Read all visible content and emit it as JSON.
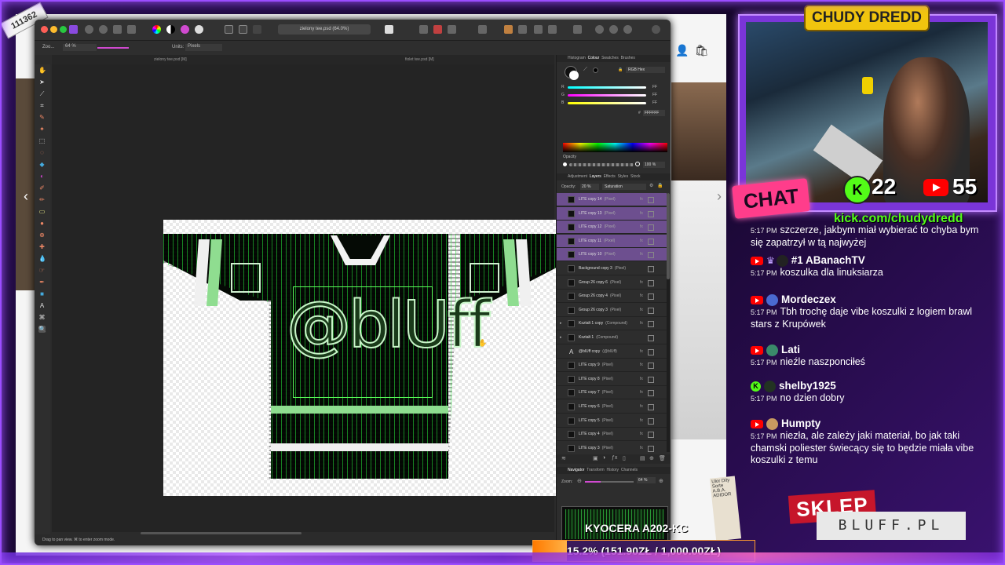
{
  "overlay": {
    "counter_badge": "111362",
    "streamer_name": "CHUDY DREDD",
    "chat_label": "CHAT",
    "kick_count": "22",
    "youtube_count": "55",
    "kick_url": "kick.com/chudydredd",
    "sklep_label": "SKLEP",
    "bluff_label": "BLUFF.PL",
    "printer_label": "KYOCERA A202-KC",
    "goal_text": "15.2% (151.90ZŁ / 1,000.00ZŁ)",
    "goal_progress": 0.152,
    "colors": {
      "accent": "#9b4dff",
      "kick": "#53fc18",
      "youtube": "#ff0000",
      "chat_label": "#ff3d8b",
      "name_bg": "#f1c50e"
    }
  },
  "app": {
    "document_title": "zielony tee.psd (64.0%)",
    "context": {
      "zoom_label": "Zoo...",
      "zoom_value": "64 %",
      "units_label": "Units:",
      "units_value": "Pixels"
    },
    "tabs": [
      "zielony tee.psd [M]",
      "fiolet tee.psd [M]"
    ],
    "status": "Drag to pan view. ⌘ to enter zoom mode.",
    "document": {
      "logo_text": "@blUff"
    },
    "colour_panel": {
      "tabs": [
        "Histogram",
        "Colour",
        "Swatches",
        "Brushes"
      ],
      "active_tab": "Colour",
      "mode": "RGB Hex",
      "channels": [
        {
          "label": "R",
          "value": "FF"
        },
        {
          "label": "G",
          "value": "FF"
        },
        {
          "label": "B",
          "value": "FF"
        }
      ],
      "hex_label": "#",
      "hex": "FFFFFF",
      "opacity_label": "Opacity",
      "opacity_value": "100 %"
    },
    "layers_panel": {
      "tabs": [
        "Adjustment",
        "Layers",
        "Effects",
        "Styles",
        "Stock"
      ],
      "active_tab": "Layers",
      "opacity_label": "Opacity:",
      "opacity_value": "20 %",
      "blend_mode": "Saturation",
      "layers": [
        {
          "name": "LITE copy 14",
          "type": "(Pixel)",
          "selected": true,
          "expandable": false,
          "fx": true,
          "icon": "pixel"
        },
        {
          "name": "LITE copy 13",
          "type": "(Pixel)",
          "selected": true,
          "expandable": false,
          "fx": true,
          "icon": "pixel"
        },
        {
          "name": "LITE copy 12",
          "type": "(Pixel)",
          "selected": true,
          "expandable": false,
          "fx": true,
          "icon": "pixel"
        },
        {
          "name": "LITE copy 11",
          "type": "(Pixel)",
          "selected": true,
          "expandable": false,
          "fx": true,
          "icon": "pixel"
        },
        {
          "name": "LITE copy 10",
          "type": "(Pixel)",
          "selected": true,
          "expandable": false,
          "fx": true,
          "icon": "pixel"
        },
        {
          "name": "Background copy 3",
          "type": "(Pixel)",
          "selected": false,
          "expandable": false,
          "fx": false,
          "icon": "pixel"
        },
        {
          "name": "Group 26 copy 6",
          "type": "(Pixel)",
          "selected": false,
          "expandable": false,
          "fx": true,
          "icon": "pixel"
        },
        {
          "name": "Group 26 copy 4",
          "type": "(Pixel)",
          "selected": false,
          "expandable": false,
          "fx": true,
          "icon": "pixel"
        },
        {
          "name": "Group 26 copy 3",
          "type": "(Pixel)",
          "selected": false,
          "expandable": false,
          "fx": true,
          "icon": "pixel"
        },
        {
          "name": "Kształt 1 copy",
          "type": "(Compound)",
          "selected": false,
          "expandable": true,
          "fx": true,
          "icon": "pixel"
        },
        {
          "name": "Kształt 1",
          "type": "(Compound)",
          "selected": false,
          "expandable": true,
          "fx": false,
          "icon": "pixel"
        },
        {
          "name": "@blUff copy",
          "type": "(@blUff)",
          "selected": false,
          "expandable": false,
          "fx": true,
          "icon": "text"
        },
        {
          "name": "LITE copy 9",
          "type": "(Pixel)",
          "selected": false,
          "expandable": false,
          "fx": true,
          "icon": "pixel"
        },
        {
          "name": "LITE copy 8",
          "type": "(Pixel)",
          "selected": false,
          "expandable": false,
          "fx": true,
          "icon": "pixel"
        },
        {
          "name": "LITE copy 7",
          "type": "(Pixel)",
          "selected": false,
          "expandable": false,
          "fx": true,
          "icon": "pixel"
        },
        {
          "name": "LITE copy 6",
          "type": "(Pixel)",
          "selected": false,
          "expandable": false,
          "fx": true,
          "icon": "pixel"
        },
        {
          "name": "LITE copy 5",
          "type": "(Pixel)",
          "selected": false,
          "expandable": false,
          "fx": true,
          "icon": "pixel"
        },
        {
          "name": "LITE copy 4",
          "type": "(Pixel)",
          "selected": false,
          "expandable": false,
          "fx": true,
          "icon": "pixel"
        },
        {
          "name": "LITE copy 3",
          "type": "(Pixel)",
          "selected": false,
          "expandable": false,
          "fx": true,
          "icon": "pixel"
        }
      ]
    },
    "navigator_panel": {
      "tabs": [
        "Navigator",
        "Transform",
        "History",
        "Channels"
      ],
      "active_tab": "Navigator",
      "zoom_label": "Zoom:",
      "zoom_value": "64 %"
    }
  },
  "chat": {
    "messages": [
      {
        "platform": "none",
        "user": "",
        "badge": "",
        "time": "5:17 PM",
        "text": "szczerze, jakbym miał wybierać to chyba bym się zapatrzył w tą najwyżej",
        "avatar_color": ""
      },
      {
        "platform": "youtube",
        "user": "#1 ABanachTV",
        "badge": "crown",
        "time": "5:17 PM",
        "text": "koszulka dla linuksiarza",
        "avatar_color": "#222222"
      },
      {
        "platform": "youtube",
        "user": "Mordeczex",
        "badge": "",
        "time": "5:17 PM",
        "text": "Tbh trochę daje vibe koszulki z logiem brawl stars z Krupówek",
        "avatar_color": "#4a6ad0"
      },
      {
        "platform": "youtube",
        "user": "Lati",
        "badge": "",
        "time": "5:17 PM",
        "text": "nieźle naszponciłeś",
        "avatar_color": "#3a8a6a"
      },
      {
        "platform": "kick",
        "user": "shelby1925",
        "badge": "",
        "time": "5:17 PM",
        "text": "no dzien dobry",
        "avatar_color": "#223322"
      },
      {
        "platform": "youtube",
        "user": "Humpty",
        "badge": "",
        "time": "5:17 PM",
        "text": "niezła, ale zależy jaki materiał, bo jak taki chamski poliester świecący się to będzie miała vibe koszulki z temu",
        "avatar_color": "#c89a60"
      }
    ]
  },
  "background_page": {
    "tag_text": "Ulor Dity Sorte A.B.A. ADIDOR"
  }
}
